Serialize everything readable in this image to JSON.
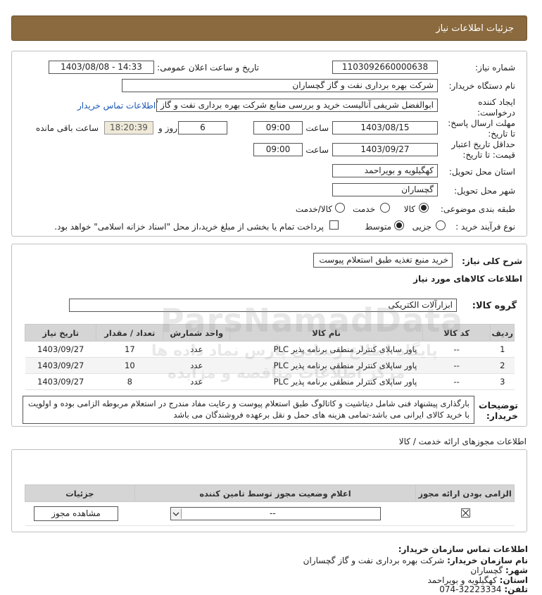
{
  "header": {
    "title": "جزئیات اطلاعات نیاز"
  },
  "form": {
    "need_number_label": "شماره نیاز:",
    "need_number": "1103092660000638",
    "announce_label": "تاریخ و ساعت اعلان عمومی:",
    "announce_value": "1403/08/08 - 14:33",
    "buyer_label": "نام دستگاه خریدار:",
    "buyer_value": "شرکت بهره برداری نفت و گاز گچساران",
    "creator_label": "ایجاد کننده درخواست:",
    "creator_value": "ابوالفضل شریفی آنالیست خرید و بررسی منابع شرکت بهره برداری نفت و گاز گچساران",
    "contact_link": "اطلاعات تماس خریدار",
    "deadline_label": "مهلت ارسال پاسخ: تا تاریخ:",
    "deadline_date": "1403/08/15",
    "time_word": "ساعت",
    "deadline_time": "09:00",
    "days_value": "6",
    "days_word": "روز و",
    "remaining_time": "18:20:39",
    "remaining_word": "ساعت باقی مانده",
    "validity_label": "حداقل تاریخ اعتبار قیمت: تا تاریخ:",
    "validity_date": "1403/09/27",
    "validity_time": "09:00",
    "province_label": "استان محل تحویل:",
    "province_value": "کهگیلویه و بویراحمد",
    "city_label": "شهر محل تحویل:",
    "city_value": "گچساران",
    "category_label": "طبقه بندی موضوعی:",
    "category_options": [
      "کالا",
      "خدمت",
      "کالا/خدمت"
    ],
    "category_selected": "کالا",
    "process_label": "نوع فرآیند خرید :",
    "process_options": [
      "جزیی",
      "متوسط"
    ],
    "process_selected": "متوسط",
    "payment_note": "پرداخت تمام یا بخشی از مبلغ خرید،از محل \"اسناد خزانه اسلامی\" خواهد بود."
  },
  "summary": {
    "desc_label": "شرح کلی نیاز:",
    "desc_value": "خرید منبع تغذیه طبق استعلام پیوست",
    "goods_title": "اطلاعات کالاهای مورد نیاز",
    "group_label": "گروه کالا:",
    "group_value": "ابزارآلات الکتریکی"
  },
  "items_table": {
    "headers": [
      "ردیف",
      "کد کالا",
      "نام کالا",
      "واحد شمارش",
      "تعداد / مقدار",
      "تاریخ نیاز"
    ],
    "rows": [
      {
        "row": "1",
        "code": "--",
        "name": "پاور ساپلای کنترلر منطقی برنامه پذیر PLC",
        "unit": "عدد",
        "qty": "17",
        "date": "1403/09/27"
      },
      {
        "row": "2",
        "code": "--",
        "name": "پاور ساپلای کنترلر منطقی برنامه پذیر PLC",
        "unit": "عدد",
        "qty": "10",
        "date": "1403/09/27"
      },
      {
        "row": "3",
        "code": "--",
        "name": "پاور ساپلای کنترلر منطقی برنامه پذیر PLC",
        "unit": "عدد",
        "qty": "8",
        "date": "1403/09/27"
      }
    ]
  },
  "buyer_notes": {
    "label": "توضیحات خریدار:",
    "text": "بارگذاری پیشنهاد فنی شامل دیتاشیت و کاتالوگ طبق استعلام پیوست و رعایت مفاد مندرج در استعلام مربوطه الزامی بوده و اولویت با خرید کالای ایرانی می باشد-تمامی هزینه های حمل و نقل برعهده فروشندگان می باشد"
  },
  "permits": {
    "title": "اطلاعات مجوزهای ارائه خدمت / کالا",
    "headers": [
      "الزامی بودن ارائه مجوز",
      "اعلام وضعیت مجوز توسط تامین کننده",
      "جزئیات"
    ],
    "select_value": "--",
    "view_button": "مشاهده مجوز"
  },
  "contact": {
    "title": "اطلاعات تماس سازمان خریدار:",
    "org_label": "نام سازمان خریدار:",
    "org_value": "شرکت بهره برداری نفت و گاز گچساران",
    "city_label": "شهر:",
    "city_value": "گچساران",
    "province_label": "استان:",
    "province_value": "کهگیلویه و بویراحمد",
    "phone_label": "تلفن:",
    "phone_value": "074-32223334"
  },
  "watermark": {
    "line1": "ParsNamadData",
    "line2": "پایگاه اطلاع رسانی پارس نماد داده ها",
    "line3": "مرکز اطلاعات مناقصه و مزایده"
  },
  "colors": {
    "header_bg": "#8a6a3e",
    "link": "#1a56b8",
    "table_header": "#d5d5d5"
  }
}
